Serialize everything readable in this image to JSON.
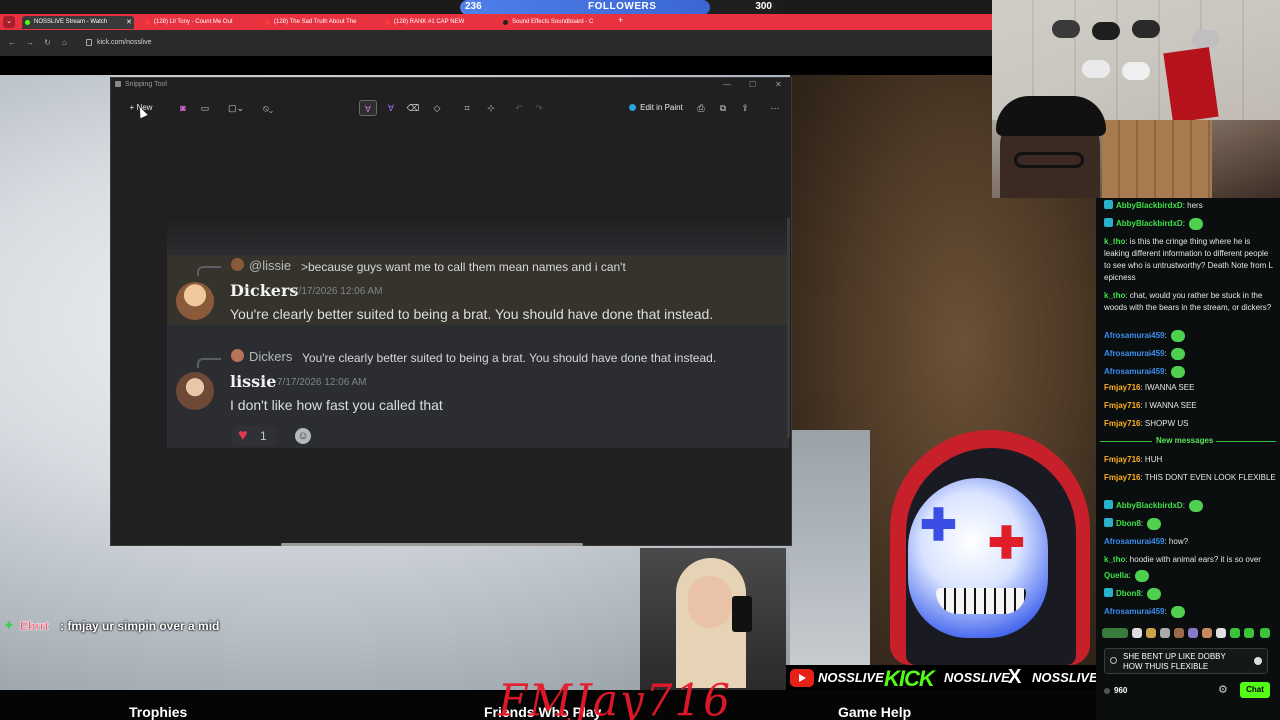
{
  "stream_overlay": {
    "followers": {
      "current": "236",
      "label": "FOLLOWERS",
      "goal": "300",
      "progress": 0.787,
      "color": "#4f7fe8"
    },
    "overlay_chat": {
      "user": "Ebrrt",
      "message": ": fmjay ur simpin over a mid"
    },
    "social": {
      "youtube": "NOSSLIVE",
      "kick_logo": "KICK",
      "kick": "NOSSLIVE",
      "x_logo": "X",
      "x": "NOSSLIVE"
    },
    "signature": "FMJay716",
    "bottom_items": [
      "Trophies",
      "Friends Who Play",
      "Game Help"
    ]
  },
  "browser": {
    "menu_icon": "chevron-down-icon",
    "tabs": [
      {
        "title": "NOSSLIVE Stream - Watch",
        "active": true
      },
      {
        "title": "(128) Lil Tony - Count Me Out",
        "active": false
      },
      {
        "title": "(128) The Sad Truth About The",
        "active": false
      },
      {
        "title": "(128) RANK #1 CAP NEW",
        "active": false
      },
      {
        "title": "Sound Effects Soundboard - C",
        "active": false
      }
    ],
    "new_tab": "+",
    "url": "kick.com/nosslive"
  },
  "snipping_tool": {
    "title": "Snipping Tool",
    "new_button": "New",
    "edit_in_paint": "Edit in Paint",
    "discord": {
      "messages": [
        {
          "reply_to": "@lissie",
          "reply_text": ">because guys want me to call them mean names and i can't",
          "author": "Dickers",
          "timestamp": "7/17/2026 12:06 AM",
          "text": "You're clearly better suited to being a brat. You should have done that instead."
        },
        {
          "reply_to": "Dickers",
          "reply_text": "You're clearly better suited to being a brat. You should have done that instead.",
          "author": "lissie",
          "timestamp": "7/17/2026 12:06 AM",
          "text": "I don't like how fast you called that",
          "reaction_count": "1"
        }
      ]
    }
  },
  "chat": {
    "lines": [
      {
        "user": "AbbyBlackbirdxD",
        "user_color": "#3ee04a",
        "text": ": hers",
        "badge": true
      },
      {
        "user": "AbbyBlackbirdxD",
        "user_color": "#3ee04a",
        "text": ":",
        "badge": true,
        "emote": true
      },
      {
        "user": "k_tho",
        "user_color": "#3ee04a",
        "text": ": is this the cringe thing where he is leaking different information to different people to see who is untrustworthy? Death Note from L epicness",
        "badge": false
      },
      {
        "user": "k_tho",
        "user_color": "#3ee04a",
        "text": ": chat, would you rather be stuck in the woods with the bears in the stream, or dickers?",
        "badge": false
      },
      {
        "user": "Afrosamurai459",
        "user_color": "#3a8ef0",
        "text": ":",
        "badge": false,
        "emote": true
      },
      {
        "user": "Afrosamurai459",
        "user_color": "#3a8ef0",
        "text": ":",
        "badge": false,
        "emote": true
      },
      {
        "user": "Afrosamurai459",
        "user_color": "#3a8ef0",
        "text": ":",
        "badge": false,
        "emote": true
      },
      {
        "user": "Fmjay716",
        "user_color": "#ffb020",
        "text": ": IWANNA SEE",
        "badge": false
      },
      {
        "user": "Fmjay716",
        "user_color": "#ffb020",
        "text": ": I WANNA SEE",
        "badge": false
      },
      {
        "user": "Fmjay716",
        "user_color": "#ffb020",
        "text": ": SHOPW US",
        "badge": false
      }
    ],
    "new_messages_label": "New messages",
    "lines_after": [
      {
        "user": "Fmjay716",
        "user_color": "#ffb020",
        "text": ": HUH",
        "badge": false
      },
      {
        "user": "Fmjay716",
        "user_color": "#ffb020",
        "text": ": THIS DONT EVEN LOOK FLEXIBLE",
        "badge": false
      },
      {
        "user": "AbbyBlackbirdxD",
        "user_color": "#3ee04a",
        "text": ":",
        "badge": true,
        "emote": true
      },
      {
        "user": "Dbon8",
        "user_color": "#3ee04a",
        "text": ":",
        "badge": true,
        "emote": true
      },
      {
        "user": "Afrosamurai459",
        "user_color": "#3a8ef0",
        "text": ": how?",
        "badge": false
      },
      {
        "user": "k_tho",
        "user_color": "#3ee04a",
        "text": ": hoodie with animal ears? it is so over",
        "badge": false
      },
      {
        "user": "Quella",
        "user_color": "#3ee04a",
        "text": ":",
        "badge": false,
        "emote": true
      },
      {
        "user": "Dbon8",
        "user_color": "#3ee04a",
        "text": ":",
        "badge": true,
        "emote": true
      },
      {
        "user": "Afrosamurai459",
        "user_color": "#3a8ef0",
        "text": ":",
        "badge": false,
        "emote": true
      }
    ],
    "input_text": "SHE BENT UP LIKE DOBBY HOW THUIS FLEXIBLE",
    "viewers": "960",
    "send_label": "Chat"
  }
}
